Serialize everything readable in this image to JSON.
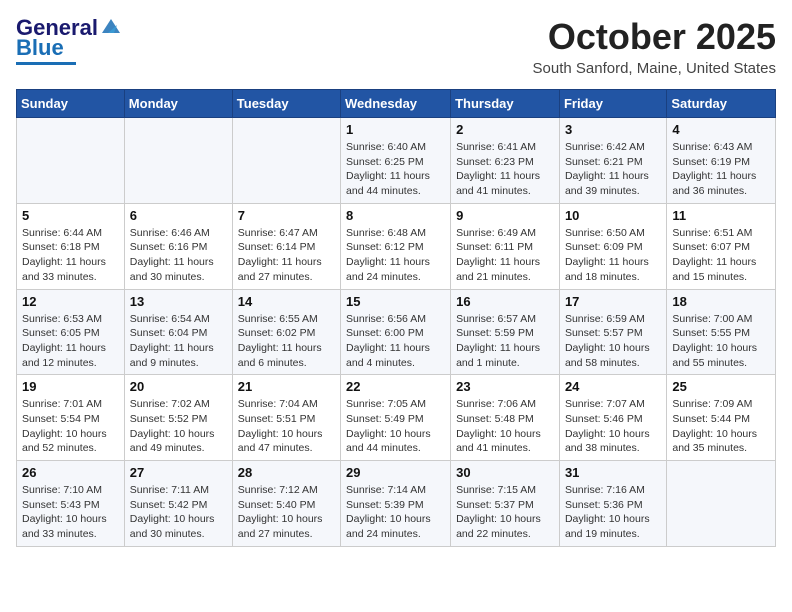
{
  "header": {
    "logo_line1": "General",
    "logo_line2": "Blue",
    "month": "October 2025",
    "location": "South Sanford, Maine, United States"
  },
  "days_of_week": [
    "Sunday",
    "Monday",
    "Tuesday",
    "Wednesday",
    "Thursday",
    "Friday",
    "Saturday"
  ],
  "weeks": [
    [
      {
        "day": "",
        "info": ""
      },
      {
        "day": "",
        "info": ""
      },
      {
        "day": "",
        "info": ""
      },
      {
        "day": "1",
        "info": "Sunrise: 6:40 AM\nSunset: 6:25 PM\nDaylight: 11 hours and 44 minutes."
      },
      {
        "day": "2",
        "info": "Sunrise: 6:41 AM\nSunset: 6:23 PM\nDaylight: 11 hours and 41 minutes."
      },
      {
        "day": "3",
        "info": "Sunrise: 6:42 AM\nSunset: 6:21 PM\nDaylight: 11 hours and 39 minutes."
      },
      {
        "day": "4",
        "info": "Sunrise: 6:43 AM\nSunset: 6:19 PM\nDaylight: 11 hours and 36 minutes."
      }
    ],
    [
      {
        "day": "5",
        "info": "Sunrise: 6:44 AM\nSunset: 6:18 PM\nDaylight: 11 hours and 33 minutes."
      },
      {
        "day": "6",
        "info": "Sunrise: 6:46 AM\nSunset: 6:16 PM\nDaylight: 11 hours and 30 minutes."
      },
      {
        "day": "7",
        "info": "Sunrise: 6:47 AM\nSunset: 6:14 PM\nDaylight: 11 hours and 27 minutes."
      },
      {
        "day": "8",
        "info": "Sunrise: 6:48 AM\nSunset: 6:12 PM\nDaylight: 11 hours and 24 minutes."
      },
      {
        "day": "9",
        "info": "Sunrise: 6:49 AM\nSunset: 6:11 PM\nDaylight: 11 hours and 21 minutes."
      },
      {
        "day": "10",
        "info": "Sunrise: 6:50 AM\nSunset: 6:09 PM\nDaylight: 11 hours and 18 minutes."
      },
      {
        "day": "11",
        "info": "Sunrise: 6:51 AM\nSunset: 6:07 PM\nDaylight: 11 hours and 15 minutes."
      }
    ],
    [
      {
        "day": "12",
        "info": "Sunrise: 6:53 AM\nSunset: 6:05 PM\nDaylight: 11 hours and 12 minutes."
      },
      {
        "day": "13",
        "info": "Sunrise: 6:54 AM\nSunset: 6:04 PM\nDaylight: 11 hours and 9 minutes."
      },
      {
        "day": "14",
        "info": "Sunrise: 6:55 AM\nSunset: 6:02 PM\nDaylight: 11 hours and 6 minutes."
      },
      {
        "day": "15",
        "info": "Sunrise: 6:56 AM\nSunset: 6:00 PM\nDaylight: 11 hours and 4 minutes."
      },
      {
        "day": "16",
        "info": "Sunrise: 6:57 AM\nSunset: 5:59 PM\nDaylight: 11 hours and 1 minute."
      },
      {
        "day": "17",
        "info": "Sunrise: 6:59 AM\nSunset: 5:57 PM\nDaylight: 10 hours and 58 minutes."
      },
      {
        "day": "18",
        "info": "Sunrise: 7:00 AM\nSunset: 5:55 PM\nDaylight: 10 hours and 55 minutes."
      }
    ],
    [
      {
        "day": "19",
        "info": "Sunrise: 7:01 AM\nSunset: 5:54 PM\nDaylight: 10 hours and 52 minutes."
      },
      {
        "day": "20",
        "info": "Sunrise: 7:02 AM\nSunset: 5:52 PM\nDaylight: 10 hours and 49 minutes."
      },
      {
        "day": "21",
        "info": "Sunrise: 7:04 AM\nSunset: 5:51 PM\nDaylight: 10 hours and 47 minutes."
      },
      {
        "day": "22",
        "info": "Sunrise: 7:05 AM\nSunset: 5:49 PM\nDaylight: 10 hours and 44 minutes."
      },
      {
        "day": "23",
        "info": "Sunrise: 7:06 AM\nSunset: 5:48 PM\nDaylight: 10 hours and 41 minutes."
      },
      {
        "day": "24",
        "info": "Sunrise: 7:07 AM\nSunset: 5:46 PM\nDaylight: 10 hours and 38 minutes."
      },
      {
        "day": "25",
        "info": "Sunrise: 7:09 AM\nSunset: 5:44 PM\nDaylight: 10 hours and 35 minutes."
      }
    ],
    [
      {
        "day": "26",
        "info": "Sunrise: 7:10 AM\nSunset: 5:43 PM\nDaylight: 10 hours and 33 minutes."
      },
      {
        "day": "27",
        "info": "Sunrise: 7:11 AM\nSunset: 5:42 PM\nDaylight: 10 hours and 30 minutes."
      },
      {
        "day": "28",
        "info": "Sunrise: 7:12 AM\nSunset: 5:40 PM\nDaylight: 10 hours and 27 minutes."
      },
      {
        "day": "29",
        "info": "Sunrise: 7:14 AM\nSunset: 5:39 PM\nDaylight: 10 hours and 24 minutes."
      },
      {
        "day": "30",
        "info": "Sunrise: 7:15 AM\nSunset: 5:37 PM\nDaylight: 10 hours and 22 minutes."
      },
      {
        "day": "31",
        "info": "Sunrise: 7:16 AM\nSunset: 5:36 PM\nDaylight: 10 hours and 19 minutes."
      },
      {
        "day": "",
        "info": ""
      }
    ]
  ]
}
